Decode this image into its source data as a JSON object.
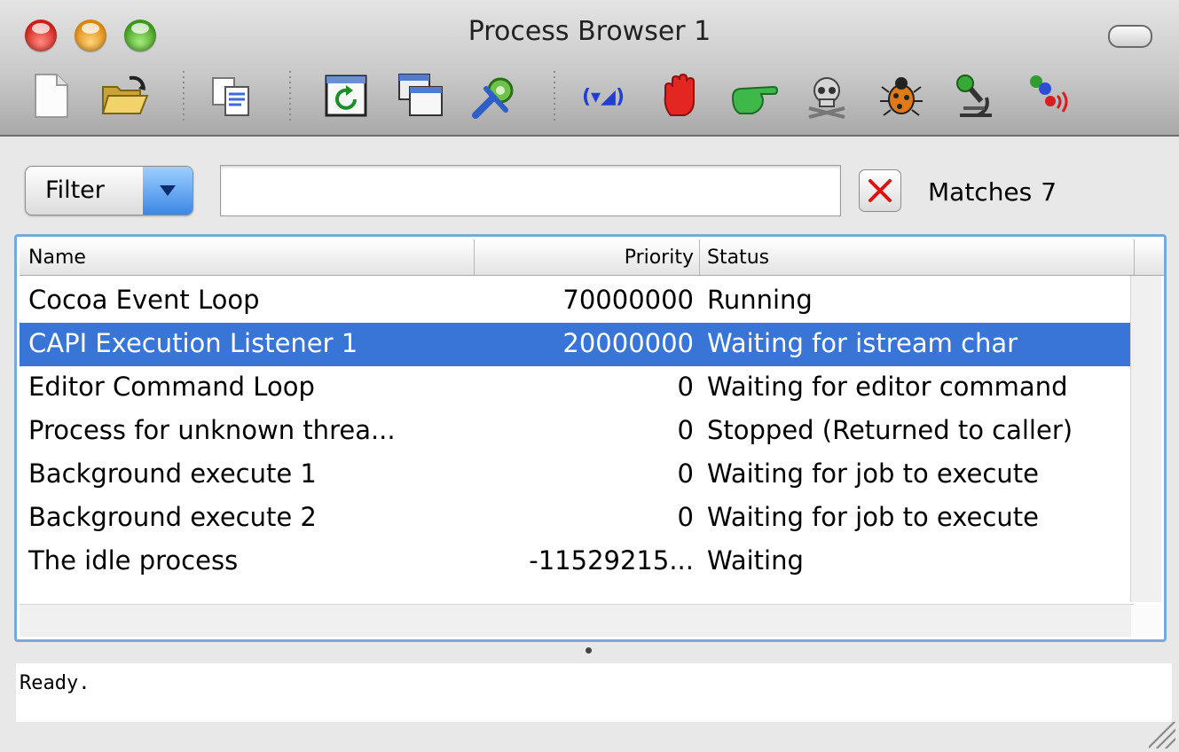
{
  "window": {
    "title": "Process Browser 1"
  },
  "toolbar": {
    "icons": [
      "new-document-icon",
      "open-folder-icon",
      "copy-icon",
      "refresh-icon",
      "windows-icon",
      "tools-gear-icon",
      "break-icon",
      "stop-hand-icon",
      "continue-pointing-hand-icon",
      "kill-skull-icon",
      "debug-bug-icon",
      "inspect-microscope-icon",
      "listen-icon"
    ]
  },
  "filter": {
    "label": "Filter",
    "value": "",
    "matches_label": "Matches",
    "matches_count": "7"
  },
  "table": {
    "columns": [
      "Name",
      "Priority",
      "Status"
    ],
    "rows": [
      {
        "name": "Cocoa Event Loop",
        "priority": "70000000",
        "status": "Running",
        "selected": false
      },
      {
        "name": "CAPI Execution Listener 1",
        "priority": "20000000",
        "status": "Waiting for istream char",
        "selected": true
      },
      {
        "name": "Editor Command Loop",
        "priority": "0",
        "status": "Waiting for editor command",
        "selected": false
      },
      {
        "name": "Process for unknown threa...",
        "priority": "0",
        "status": "Stopped (Returned to caller)",
        "selected": false
      },
      {
        "name": "Background execute 1",
        "priority": "0",
        "status": "Waiting for job to execute",
        "selected": false
      },
      {
        "name": "Background execute 2",
        "priority": "0",
        "status": "Waiting for job to execute",
        "selected": false
      },
      {
        "name": "The idle process",
        "priority": "-11529215...",
        "status": "Waiting",
        "selected": false
      }
    ]
  },
  "status": {
    "text": "Ready."
  },
  "colors": {
    "selection": "#3875d7",
    "focus_ring": "#7aa7dc"
  }
}
